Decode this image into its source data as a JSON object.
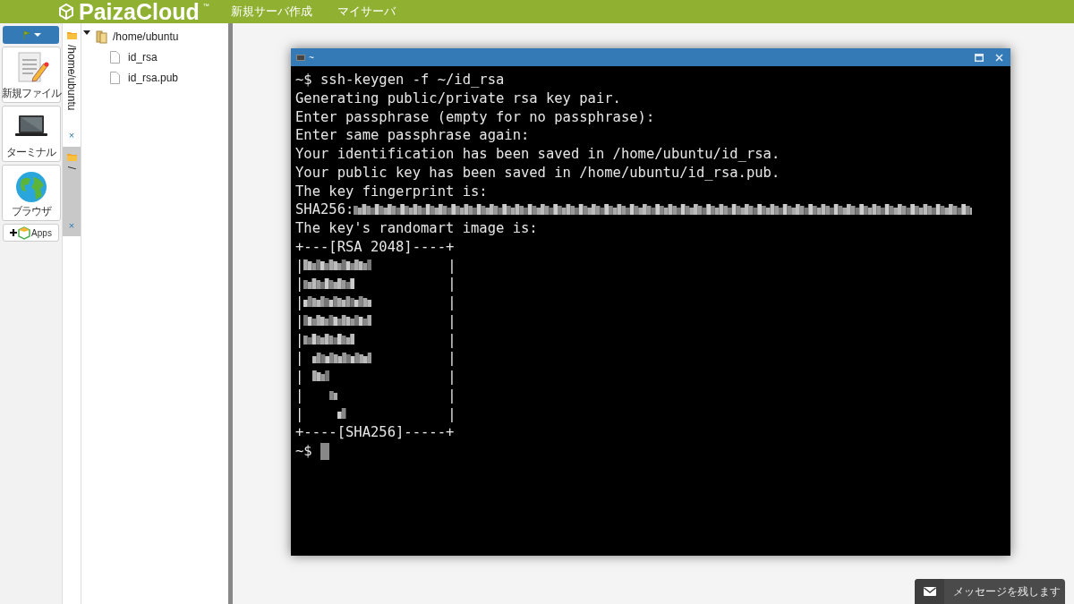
{
  "header": {
    "logo": "PaizaCloud",
    "logo_mark": "™",
    "menu": [
      "新規サーバ作成",
      "マイサーバ"
    ]
  },
  "toolbar": {
    "items": [
      {
        "kind": "file",
        "label": "新規ファイル"
      },
      {
        "kind": "terminal",
        "label": "ターミナル"
      },
      {
        "kind": "browser",
        "label": "ブラウザ"
      }
    ],
    "apps": "Apps"
  },
  "side_tabs": [
    {
      "label": "/home/ubuntu",
      "close": "×",
      "selected": true
    },
    {
      "label": "/",
      "close": "×",
      "selected": false
    }
  ],
  "tree": {
    "root": {
      "label": "/home/ubuntu",
      "expanded": true,
      "children": [
        {
          "label": "id_rsa"
        },
        {
          "label": "id_rsa.pub"
        }
      ]
    }
  },
  "terminal": {
    "title": "~",
    "lines": [
      {
        "kind": "text",
        "text": "~$ ssh-keygen -f ~/id_rsa"
      },
      {
        "kind": "text",
        "text": "Generating public/private rsa key pair."
      },
      {
        "kind": "text",
        "text": "Enter passphrase (empty for no passphrase):"
      },
      {
        "kind": "text",
        "text": "Enter same passphrase again:"
      },
      {
        "kind": "text",
        "text": "Your identification has been saved in /home/ubuntu/id_rsa."
      },
      {
        "kind": "text",
        "text": "Your public key has been saved in /home/ubuntu/id_rsa.pub."
      },
      {
        "kind": "text",
        "text": "The key fingerprint is:"
      },
      {
        "kind": "redacted",
        "text": "SHA256:"
      },
      {
        "kind": "text",
        "text": "The key's randomart image is:"
      },
      {
        "kind": "text",
        "text": "+---[RSA 2048]----+"
      },
      {
        "kind": "art",
        "left": "|",
        "right": "|"
      },
      {
        "kind": "art",
        "left": "|",
        "right": "|"
      },
      {
        "kind": "art",
        "left": "|",
        "right": "|"
      },
      {
        "kind": "art",
        "left": "|",
        "right": "|"
      },
      {
        "kind": "art",
        "left": "|",
        "right": "|"
      },
      {
        "kind": "art",
        "left": "|",
        "right": "|"
      },
      {
        "kind": "art",
        "left": "|",
        "right": "|"
      },
      {
        "kind": "art",
        "left": "|",
        "right": "|"
      },
      {
        "kind": "art",
        "left": "|",
        "right": "|"
      },
      {
        "kind": "text",
        "text": "+----[SHA256]-----+"
      },
      {
        "kind": "prompt",
        "text": "~$"
      }
    ]
  },
  "message_button": "メッセージを残します"
}
